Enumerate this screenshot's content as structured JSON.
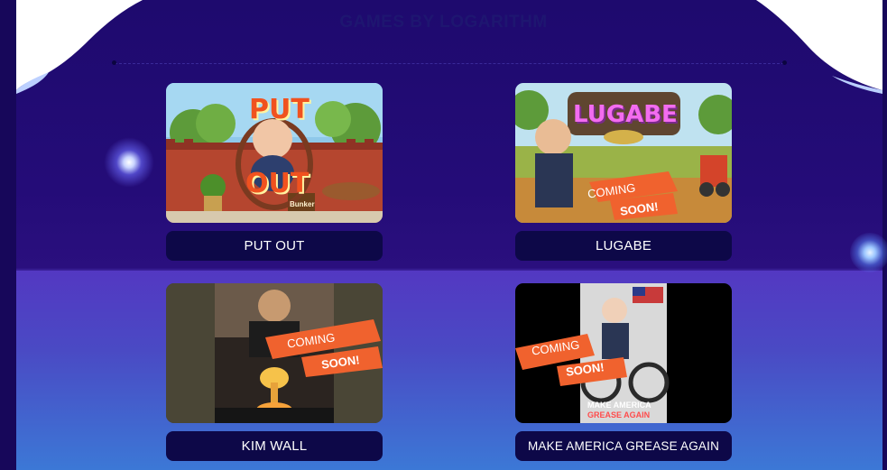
{
  "section": {
    "title": "GAMES BY LOGARITHM"
  },
  "games": [
    {
      "title": "PUT OUT",
      "thumb_title_top": "PUT",
      "thumb_title_bottom": "OUT",
      "thumb_sign": "Bunker"
    },
    {
      "title": "LUGABE",
      "thumb_title": "LUGABE",
      "ribbon_top": "COMING",
      "ribbon_bottom": "SOON!"
    },
    {
      "title": "KIM WALL",
      "ribbon_top": "COMING",
      "ribbon_bottom": "SOON!"
    },
    {
      "title": "MAKE AMERICA GREASE AGAIN",
      "ribbon_top": "COMING",
      "ribbon_bottom": "SOON!",
      "thumb_logo_top": "MAKE AMERICA",
      "thumb_logo_bottom": "GREASE AGAIN"
    }
  ],
  "colors": {
    "background_top": "#1e0a6e",
    "background_bottom": "#3a80d8",
    "button_bg": "#0d0848",
    "ribbon": "#f0622e"
  }
}
